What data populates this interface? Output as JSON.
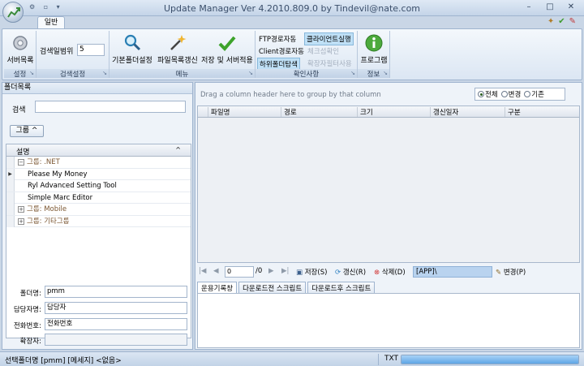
{
  "window": {
    "title": "Update Manager Ver 4.2010.809.0 by Tindevil@nate.com",
    "minimize": "–",
    "maximize": "□",
    "close": "✕",
    "qat": "⚙ ▫ ▾"
  },
  "ribbon": {
    "tab": "일반",
    "groups": {
      "settings": {
        "label": "설정",
        "server_list": "서버목록"
      },
      "search_settings": {
        "label": "검색설정",
        "range_label": "검색일범위",
        "range_value": "5"
      },
      "menu": {
        "label": "메뉴",
        "default_folder": "기본폴더설정",
        "refresh_files": "파일목록갱신",
        "save_apply": "저장 및 서버적용"
      },
      "check": {
        "label": "확인사항",
        "ftp_path": "FTP경로자동",
        "client_run": "클라이언트실행",
        "client_path": "Client경로자동",
        "checksum": "체크섬확인",
        "sub_folder": "하위폴더탐색",
        "ext_filter": "확장자필터사용"
      },
      "info": {
        "label": "정보",
        "program": "프로그램"
      }
    }
  },
  "left_panel": {
    "title": "폴더목록",
    "search_label": "검색",
    "search_value": "",
    "group_button": "그룹 ^",
    "grid_header": "설명",
    "rows": [
      {
        "type": "group",
        "label": "그룹: .NET"
      },
      {
        "type": "item",
        "label": "Please My Money"
      },
      {
        "type": "item",
        "label": "Ryl Advanced Setting Tool"
      },
      {
        "type": "item",
        "label": "Simple Marc Editor"
      },
      {
        "type": "group",
        "label": "그룹: Mobile"
      },
      {
        "type": "group",
        "label": "그룹: 기타그룹"
      }
    ],
    "form": {
      "folder_name_label": "폴더명:",
      "folder_name_value": "pmm",
      "manager_label": "담당자명:",
      "manager_value": "담당자",
      "phone_label": "전화번호:",
      "phone_value": "전화번호",
      "ext_label": "확장자:",
      "ext_value": ""
    }
  },
  "right_panel": {
    "group_hint": "Drag a column header here to group by that column",
    "radios": {
      "all": "전체",
      "changed": "변경",
      "existing": "기존"
    },
    "columns": [
      "파일명",
      "경로",
      "크기",
      "갱신일자",
      "구분"
    ],
    "nav": {
      "page_value": "0",
      "page_total": "/0",
      "save": "저장(S)",
      "refresh": "갱신(R)",
      "delete": "삭제(D)",
      "path": "[APP]\\",
      "change": "변경(P)"
    },
    "tabs": [
      "운용기록창",
      "다운로드전 스크립트",
      "다운로드후 스크립트"
    ]
  },
  "status": {
    "text": "선택폴더명 [pmm] [메세지] <없음>",
    "txt_label": "TXT",
    "progress": 1.0
  }
}
